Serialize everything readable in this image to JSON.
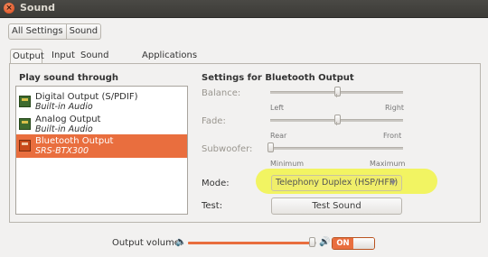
{
  "window": {
    "title": "Sound"
  },
  "breadcrumb": {
    "all_settings": "All Settings",
    "current": "Sound"
  },
  "tabs": [
    "Output",
    "Input",
    "Sound Effects",
    "Applications"
  ],
  "left": {
    "header": "Play sound through",
    "devices": [
      {
        "name": "Digital Output (S/PDIF)",
        "sub": "Built-in Audio",
        "selected": false
      },
      {
        "name": "Analog Output",
        "sub": "Built-in Audio",
        "selected": false
      },
      {
        "name": "Bluetooth Output",
        "sub": "SRS-BTX300",
        "selected": true
      }
    ]
  },
  "right": {
    "header": "Settings for Bluetooth Output",
    "balance": {
      "label": "Balance:",
      "left": "Left",
      "right": "Right",
      "value": 0.5
    },
    "fade": {
      "label": "Fade:",
      "left": "Rear",
      "right": "Front",
      "value": 0.5
    },
    "subwoofer": {
      "label": "Subwoofer:",
      "left": "Minimum",
      "right": "Maximum",
      "value": 0.0
    },
    "mode": {
      "label": "Mode:",
      "value": "Telephony Duplex (HSP/HFP)"
    },
    "test": {
      "label": "Test:",
      "button": "Test Sound"
    }
  },
  "volume": {
    "label": "Output volume:",
    "level": 0.97,
    "switch": "ON"
  },
  "colors": {
    "accent": "#e96e3e",
    "highlight": "#f1f35a",
    "titlebar": "#3c3b37"
  },
  "icons": {
    "close": "close-icon",
    "speaker_low": "speaker-low-icon",
    "speaker_high": "speaker-high-icon",
    "device": "sound-card-icon"
  }
}
